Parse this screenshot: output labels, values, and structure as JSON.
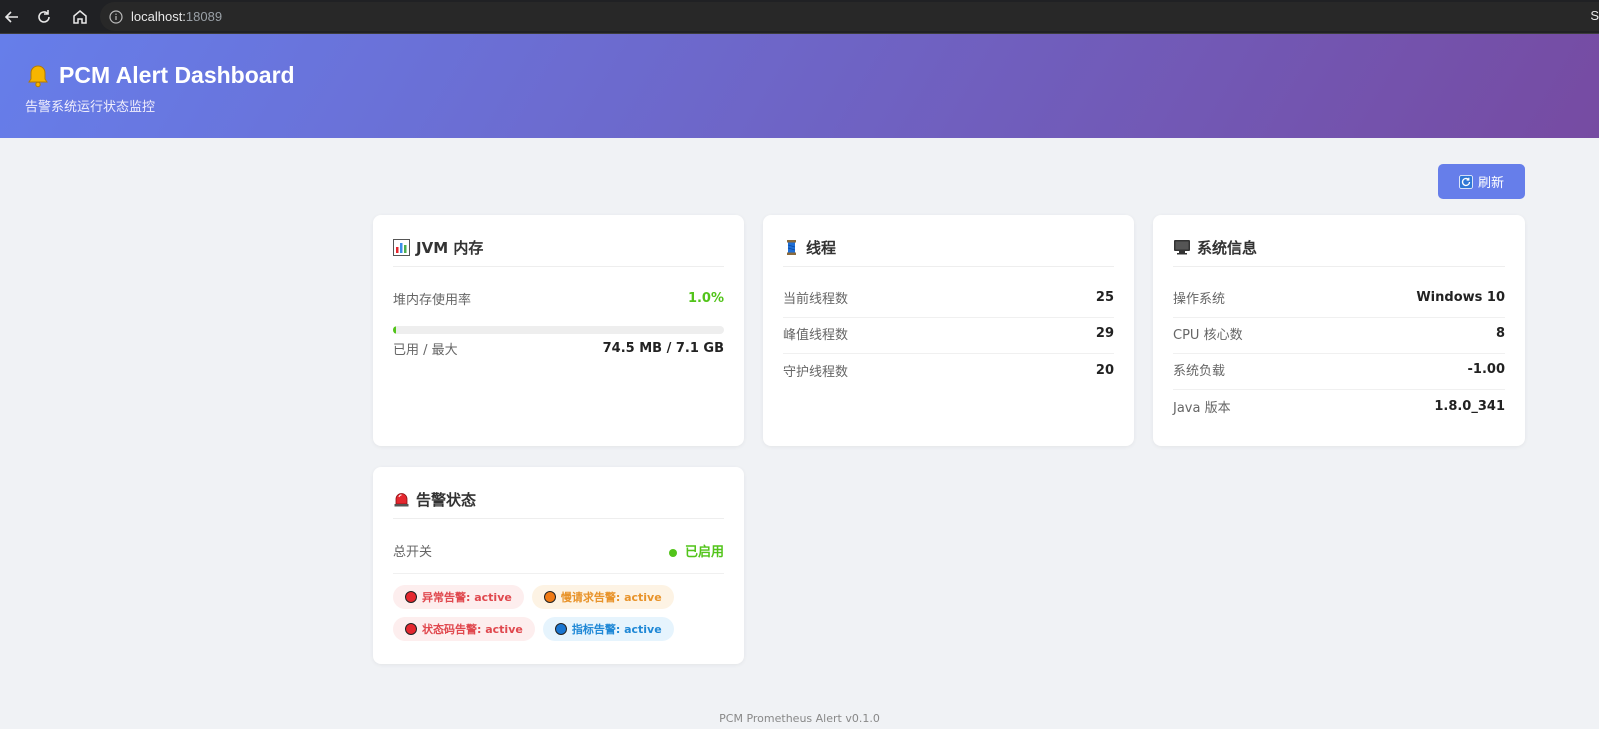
{
  "browser": {
    "url_host": "localhost:",
    "url_port": "18089",
    "edge_char": "S"
  },
  "header": {
    "title": "PCM Alert Dashboard",
    "subtitle": "告警系统运行状态监控"
  },
  "toolbar": {
    "refresh_label": "刷新"
  },
  "jvm": {
    "title": "JVM 内存",
    "heap_label": "堆内存使用率",
    "heap_value": "1.0%",
    "heap_fraction": 0.01,
    "used_label": "已用 / 最大",
    "used_value": "74.5 MB / 7.1 GB"
  },
  "threads": {
    "title": "线程",
    "rows": [
      {
        "label": "当前线程数",
        "value": "25"
      },
      {
        "label": "峰值线程数",
        "value": "29"
      },
      {
        "label": "守护线程数",
        "value": "20"
      }
    ]
  },
  "system": {
    "title": "系统信息",
    "rows": [
      {
        "label": "操作系统",
        "value": "Windows 10"
      },
      {
        "label": "CPU 核心数",
        "value": "8"
      },
      {
        "label": "系统负载",
        "value": "-1.00"
      },
      {
        "label": "Java 版本",
        "value": "1.8.0_341"
      }
    ]
  },
  "alerts": {
    "title": "告警状态",
    "switch_label": "总开关",
    "switch_value": "已启用",
    "tags": [
      {
        "label": "异常告警: active",
        "color": "#e0484e",
        "dot": "#e5272f"
      },
      {
        "label": "慢请求告警: active",
        "color": "#e8932a",
        "dot": "#f07a15"
      },
      {
        "label": "状态码告警: active",
        "color": "#e0484e",
        "dot": "#e5272f"
      },
      {
        "label": "指标告警: active",
        "color": "#1f88d6",
        "dot": "#1976d2"
      }
    ]
  },
  "footer": {
    "text": "PCM Prometheus Alert v0.1.0"
  }
}
